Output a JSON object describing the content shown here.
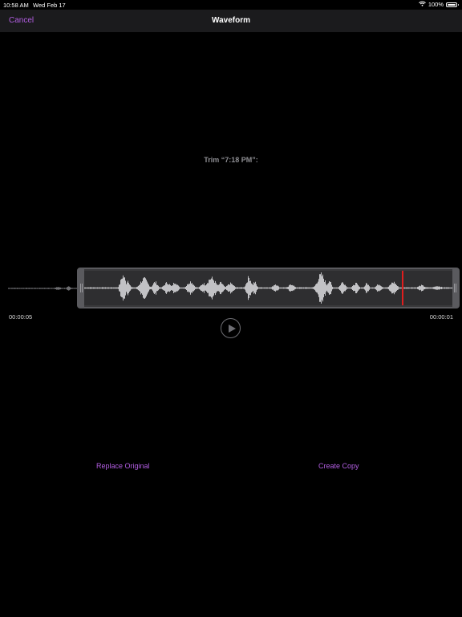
{
  "status_bar": {
    "time": "10:58 AM",
    "date": "Wed Feb 17",
    "battery": "100%",
    "battery_level": 1.0,
    "wifi_icon": "wifi-icon"
  },
  "nav": {
    "cancel_label": "Cancel",
    "title": "Waveform"
  },
  "trim": {
    "title": "Trim “7:18 PM”:",
    "start_time": "00:00:05",
    "end_time": "00:00:01"
  },
  "playback": {
    "play_icon": "play-icon"
  },
  "actions": {
    "replace_label": "Replace Original",
    "copy_label": "Create Copy"
  },
  "colors": {
    "accent": "#b25ee2",
    "playhead": "#e01e1e",
    "background": "#000000",
    "nav_background": "#1b1b1d"
  }
}
